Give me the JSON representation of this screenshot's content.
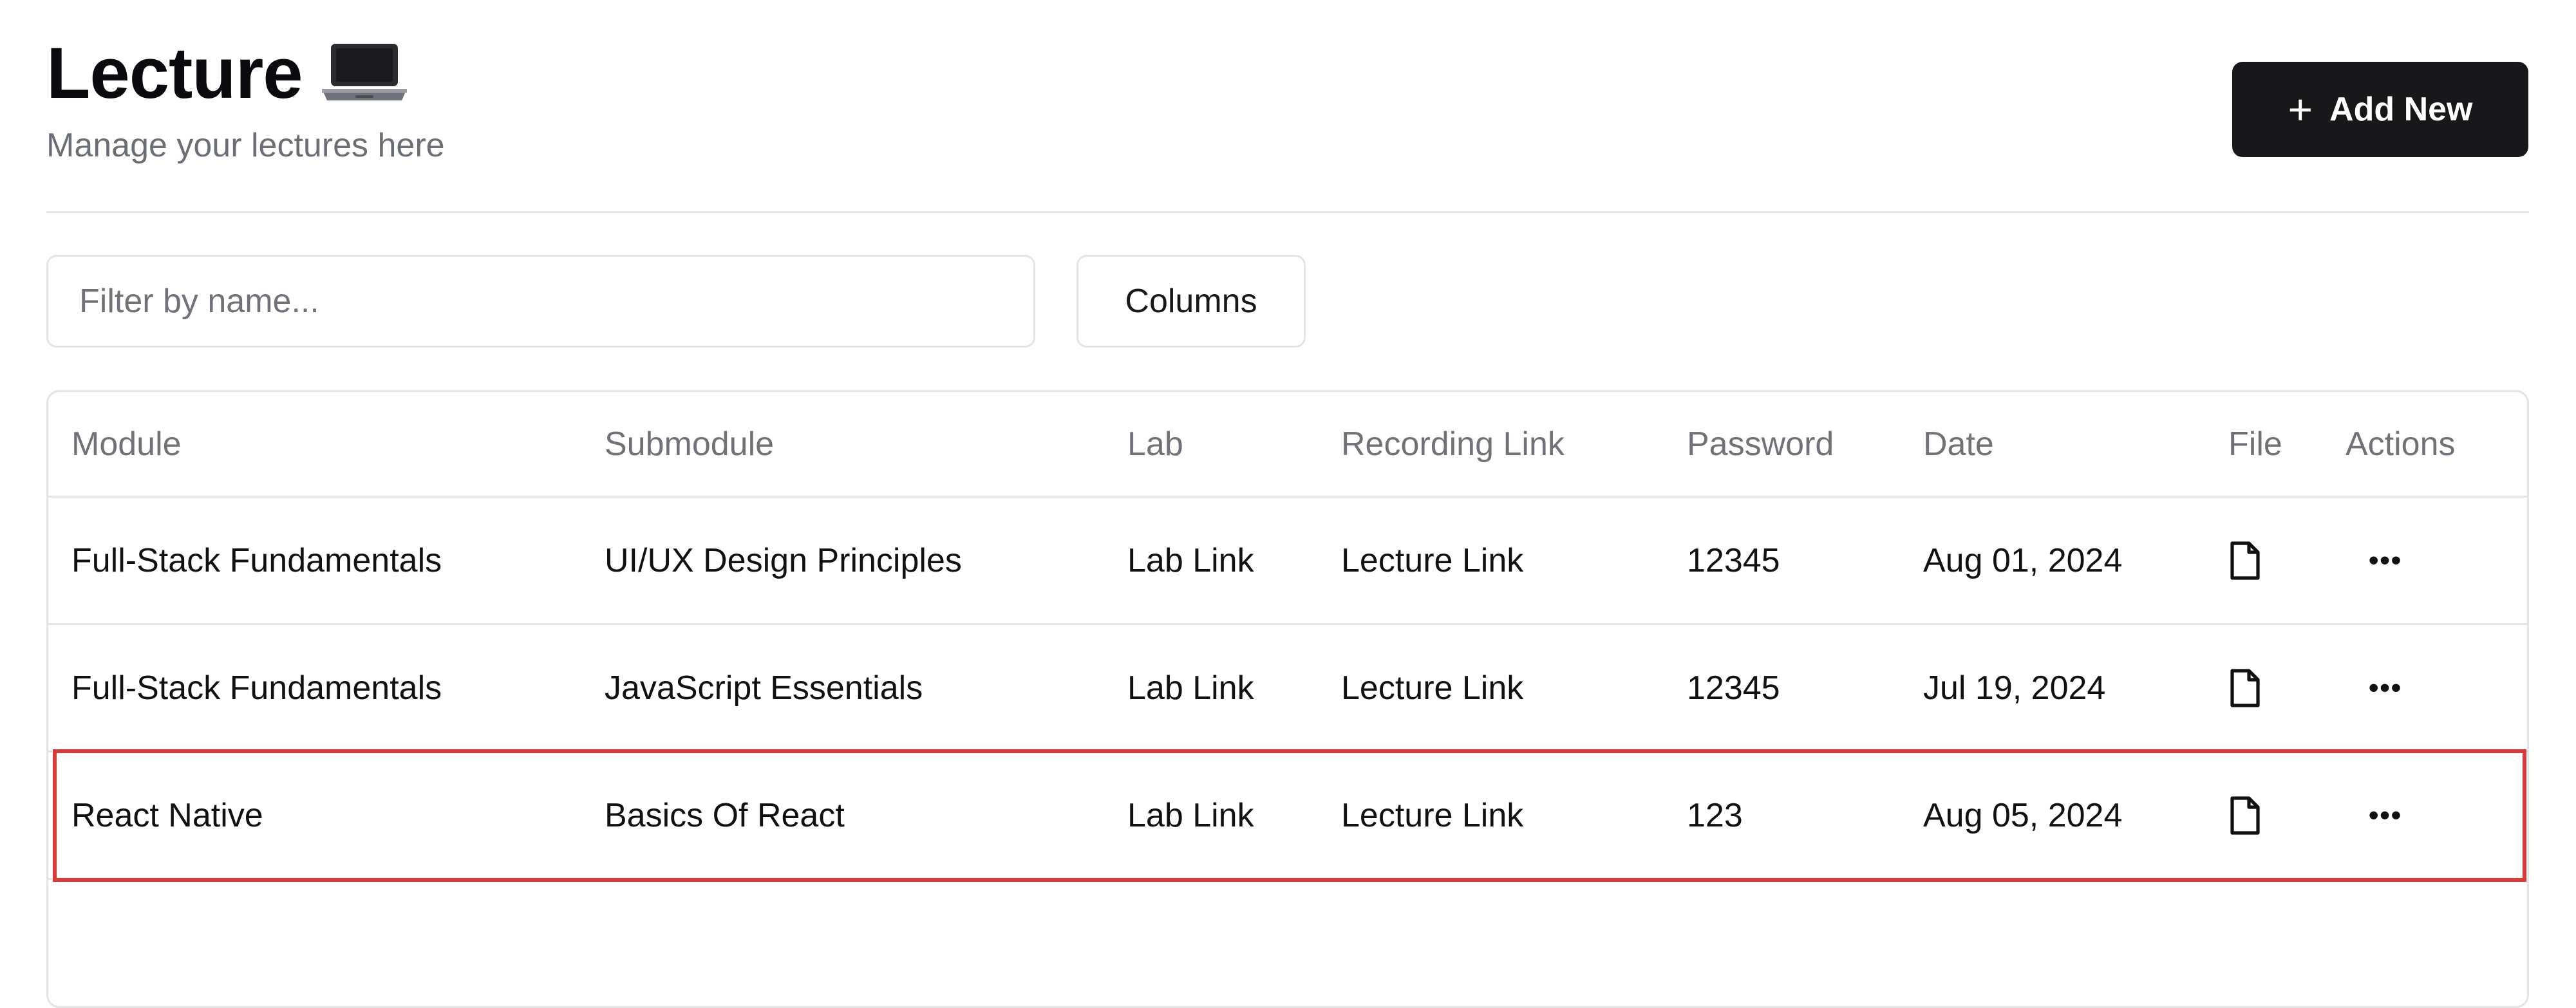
{
  "header": {
    "title": "Lecture",
    "title_icon": "laptop-icon",
    "subtitle": "Manage your lectures here",
    "add_button_label": "Add New",
    "add_button_icon": "plus-icon"
  },
  "toolbar": {
    "filter_placeholder": "Filter by name...",
    "filter_value": "",
    "columns_button_label": "Columns"
  },
  "table": {
    "columns": [
      "Module",
      "Submodule",
      "Lab",
      "Recording Link",
      "Password",
      "Date",
      "File",
      "Actions"
    ],
    "rows": [
      {
        "module": "Full-Stack Fundamentals",
        "submodule": "UI/UX Design Principles",
        "lab": "Lab Link",
        "recording": "Lecture Link",
        "password": "12345",
        "date": "Aug 01, 2024",
        "file_icon": "file-icon",
        "actions_icon": "more-horizontal-icon"
      },
      {
        "module": "Full-Stack Fundamentals",
        "submodule": "JavaScript Essentials",
        "lab": "Lab Link",
        "recording": "Lecture Link",
        "password": "12345",
        "date": "Jul 19, 2024",
        "file_icon": "file-icon",
        "actions_icon": "more-horizontal-icon"
      },
      {
        "module": "React Native",
        "submodule": "Basics Of React",
        "lab": "Lab Link",
        "recording": "Lecture Link",
        "password": "123",
        "date": "Aug 05, 2024",
        "file_icon": "file-icon",
        "actions_icon": "more-horizontal-icon"
      }
    ],
    "highlighted_row": 2
  },
  "colors": {
    "primary_button_bg": "#18181b",
    "border": "#e4e4e7",
    "muted_text": "#71717a",
    "highlight_border": "#d93a3a"
  }
}
